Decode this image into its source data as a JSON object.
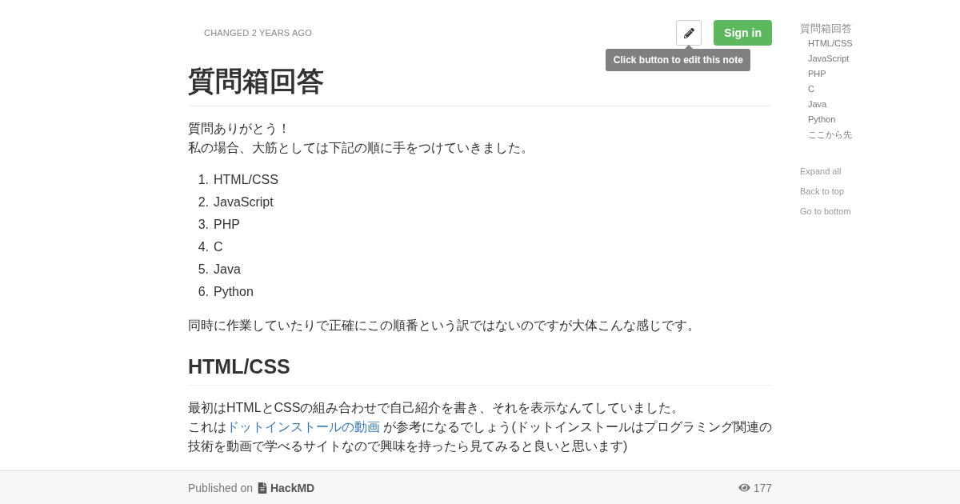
{
  "header": {
    "changed": "CHANGED 2 YEARS AGO",
    "sign_in": "Sign in",
    "tooltip": "Click button to edit this note"
  },
  "title": "質問箱回答",
  "content": [
    {
      "kind": "paragraph",
      "lines": [
        [
          {
            "kind": "text",
            "text": "質問ありがとう！"
          }
        ],
        [
          {
            "kind": "text",
            "text": "私の場合、大筋としては下記の順に手をつけていきました。"
          }
        ]
      ]
    },
    {
      "kind": "ordered_list",
      "items": [
        {
          "number": "1.",
          "text": "HTML/CSS"
        },
        {
          "number": "2.",
          "text": "JavaScript"
        },
        {
          "number": "3.",
          "text": "PHP"
        },
        {
          "number": "4.",
          "text": "C"
        },
        {
          "number": "5.",
          "text": "Java"
        },
        {
          "number": "6.",
          "text": "Python"
        }
      ]
    },
    {
      "kind": "paragraph",
      "lines": [
        [
          {
            "kind": "text",
            "text": "同時に作業していたりで正確にこの順番という訳ではないのですが大体こんな感じです。"
          }
        ]
      ]
    },
    {
      "kind": "heading",
      "text": "HTML/CSS"
    },
    {
      "kind": "paragraph",
      "lines": [
        [
          {
            "kind": "text",
            "text": "最初はHTMLとCSSの組み合わせで自己紹介を書き、それを表示なんてしていました。"
          }
        ],
        [
          {
            "kind": "text",
            "text": "これは"
          },
          {
            "kind": "link",
            "text": "ドットインストールの動画"
          },
          {
            "kind": "text",
            "text": " が参考になるでしょう(ドットインストールはプログラミング関連の技術を動画で学べるサイトなので興味を持ったら見てみると良いと思います)"
          }
        ]
      ]
    }
  ],
  "toc": [
    {
      "label": "質問箱回答",
      "children": [
        {
          "label": "HTML/CSS"
        },
        {
          "label": "JavaScript"
        },
        {
          "label": "PHP"
        },
        {
          "label": "C"
        },
        {
          "label": "Java"
        },
        {
          "label": "Python"
        },
        {
          "label": "ここから先"
        }
      ]
    }
  ],
  "toc_links": [
    "Expand all",
    "Back to top",
    "Go to bottom"
  ],
  "footer": {
    "published_on": "Published on",
    "brand": "HackMD",
    "views": "177"
  }
}
